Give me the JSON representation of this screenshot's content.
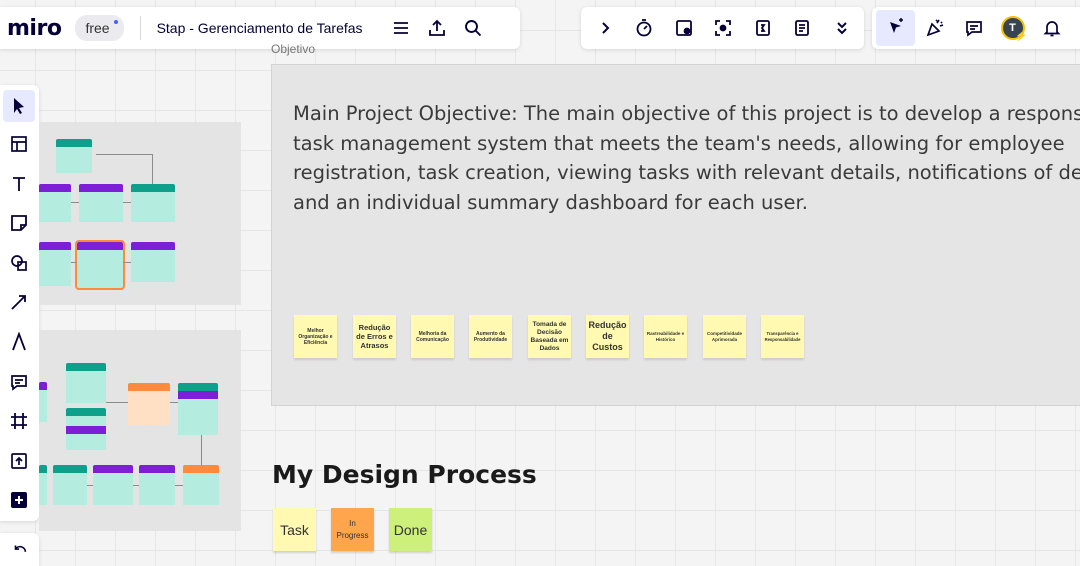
{
  "app": {
    "logo": "miro",
    "plan": "free",
    "board_title": "Stap - Gerenciamento de Tarefas"
  },
  "toolbar_left_icons": [
    "menu-icon",
    "upload-icon",
    "search-icon"
  ],
  "toolbar_mid_icons": [
    "chevron-right-icon",
    "timer-icon",
    "card-icon",
    "focus-icon",
    "count-icon",
    "notes-icon",
    "chevron-double-down-icon"
  ],
  "toolbar_right": {
    "icons": [
      "select-cursor-icon",
      "celebrate-icon",
      "comment-icon",
      "bell-icon"
    ],
    "avatar_initial": "T"
  },
  "tools": [
    "select",
    "templates",
    "text",
    "sticky-note",
    "shapes",
    "connection-line",
    "pen",
    "comment",
    "frame",
    "upload",
    "more"
  ],
  "objective": {
    "label": "Objetivo",
    "lines": [
      "Main Project Objective: The main objective of this project is to develop a responsive",
      "task management system that meets the team's needs, allowing for employee",
      "registration, task creation, viewing tasks with relevant details, notifications of delays",
      "and an individual summary dashboard for each user."
    ]
  },
  "benefit_notes": [
    "Melhor Organização e Eficiência",
    "Redução de Erros e Atrasos",
    "Melhoria da Comunicação",
    "Aumento da Produtividade",
    "Tomada de Decisão Baseada em Dados",
    "Redução de Custos",
    "Rastreabilidade e Histórico",
    "Competitividade Aprimorada",
    "Transparência e Responsabilidade"
  ],
  "design_process": {
    "title": "My Design Process",
    "stages": [
      {
        "label": "Task",
        "color": "#fff9b1"
      },
      {
        "label": "In Progress",
        "color": "#ffa64d"
      },
      {
        "label": "Done",
        "color": "#cdf07a"
      }
    ]
  },
  "colors": {
    "accent": "#4262ff",
    "purple_header": "#7c1fd6",
    "teal_header": "#0fa08c",
    "orange_header": "#ff8a3d",
    "card_body": "#b4ede0"
  }
}
